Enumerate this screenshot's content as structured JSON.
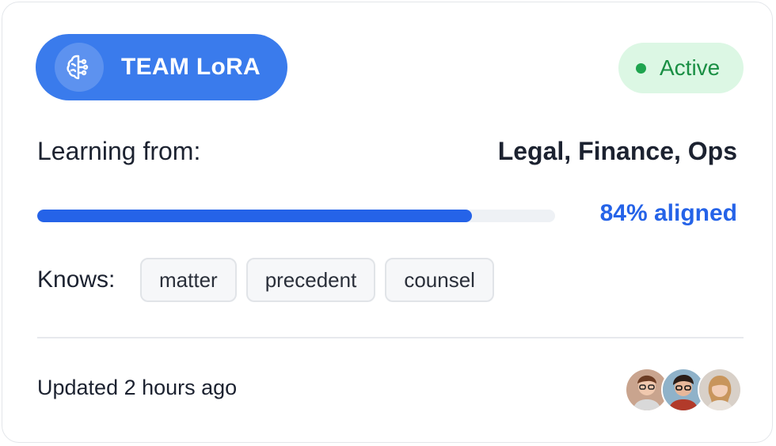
{
  "card": {
    "team_label": "TEAM LoRA",
    "team_icon": "brain-icon",
    "status": {
      "label": "Active",
      "color": "#1fa44f"
    },
    "learning": {
      "label": "Learning from:",
      "value": "Legal, Finance, Ops"
    },
    "progress": {
      "percent": 84,
      "text": "84% aligned",
      "color": "#2563e8"
    },
    "knows": {
      "label": "Knows:",
      "tags": [
        "matter",
        "precedent",
        "counsel"
      ]
    },
    "footer": {
      "updated": "Updated 2 hours ago",
      "avatars": [
        "avatar-1",
        "avatar-2",
        "avatar-3"
      ]
    }
  }
}
